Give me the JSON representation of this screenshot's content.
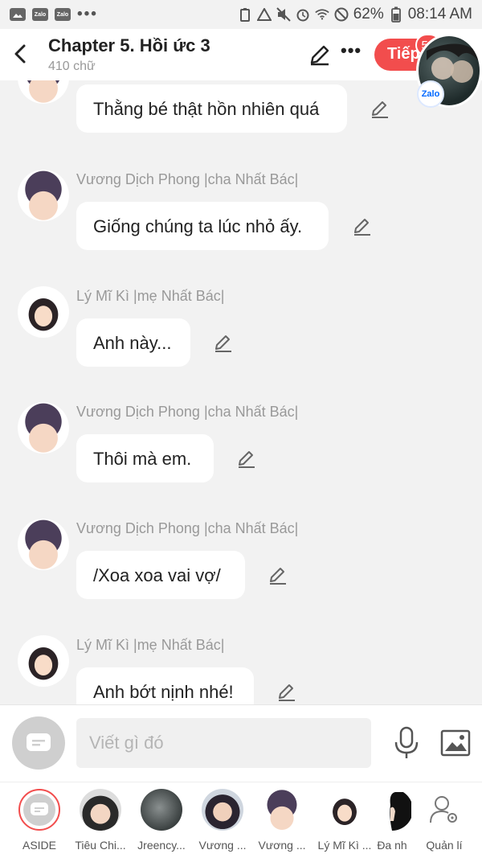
{
  "status_bar": {
    "left_icons": [
      "image-icon",
      "zalo-icon",
      "zalo-icon"
    ],
    "zalo_badge": "Zalo",
    "more": "•••",
    "battery": "62%",
    "time": "08:14 AM"
  },
  "header": {
    "title": "Chapter 5. Hồi ức 3",
    "subtitle": "410 chữ",
    "more": "•••",
    "next_label": "Tiếp",
    "next_badge": "5+",
    "zalo_label": "Zalo"
  },
  "messages": [
    {
      "sender": "",
      "text": "Thằng bé thật hồn nhiên quá",
      "avatar": "male"
    },
    {
      "sender": "Vương Dịch Phong |cha Nhất Bác|",
      "text": "Giống chúng ta lúc nhỏ ấy.",
      "avatar": "male"
    },
    {
      "sender": "Lý Mĩ Kì |mẹ Nhất Bác|",
      "text": "Anh này...",
      "avatar": "female"
    },
    {
      "sender": "Vương Dịch Phong |cha Nhất Bác|",
      "text": "Thôi mà em.",
      "avatar": "male"
    },
    {
      "sender": "Vương Dịch Phong |cha Nhất Bác|",
      "text": "/Xoa xoa vai vợ/",
      "avatar": "male"
    },
    {
      "sender": "Lý Mĩ Kì |mẹ Nhất Bác|",
      "text": "Anh bớt nịnh nhé!",
      "avatar": "female"
    }
  ],
  "composer": {
    "placeholder": "Viết gì đó"
  },
  "bottom_tabs": [
    {
      "label": "ASIDE"
    },
    {
      "label": "Tiêu Chi..."
    },
    {
      "label": "Jreency..."
    },
    {
      "label": "Vương ..."
    },
    {
      "label": "Vương ..."
    },
    {
      "label": "Lý Mĩ Kì ..."
    },
    {
      "label": "Đa nh"
    },
    {
      "label": "Quản lí"
    }
  ],
  "colors": {
    "accent": "#f24d4d",
    "background": "#f2f2f2",
    "bubble": "#ffffff",
    "sender_text": "#999999"
  }
}
